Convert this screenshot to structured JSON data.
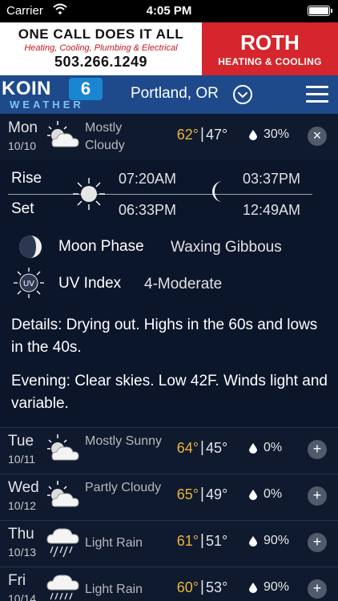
{
  "status_bar": {
    "carrier": "Carrier",
    "time": "4:05 PM"
  },
  "ad": {
    "line1": "ONE CALL DOES IT ALL",
    "line2": "Heating, Cooling, Plumbing & Electrical",
    "phone": "503.266.1249",
    "brand": "ROTH",
    "brand_sub": "HEATING & COOLING"
  },
  "header": {
    "logo_main": "KOIN",
    "logo_number": "6",
    "logo_sub": "WEATHER",
    "location": "Portland, OR"
  },
  "colors": {
    "high_temp": "#eab53a",
    "header_bg": "#1e4a8c",
    "background": "#0f1a2f"
  },
  "days": [
    {
      "name": "Mon",
      "date": "10/10",
      "condition": "Mostly Cloudy",
      "high": "62°",
      "low": "47°",
      "precip": "30%",
      "icon": "partly-cloudy-icon",
      "action": "×"
    },
    {
      "name": "Tue",
      "date": "10/11",
      "condition": "Mostly Sunny",
      "high": "64°",
      "low": "45°",
      "precip": "0%",
      "icon": "partly-cloudy-icon",
      "action": "+"
    },
    {
      "name": "Wed",
      "date": "10/12",
      "condition": "Partly Cloudy",
      "high": "65°",
      "low": "49°",
      "precip": "0%",
      "icon": "partly-cloudy-icon",
      "action": "+"
    },
    {
      "name": "Thu",
      "date": "10/13",
      "condition": "Light Rain",
      "high": "61°",
      "low": "51°",
      "precip": "90%",
      "icon": "rain-cloud-icon",
      "action": "+"
    },
    {
      "name": "Fri",
      "date": "10/14",
      "condition": "Light Rain",
      "high": "60°",
      "low": "53°",
      "precip": "90%",
      "icon": "rain-cloud-icon",
      "action": "+"
    }
  ],
  "details": {
    "rise_label": "Rise",
    "set_label": "Set",
    "sunrise": "07:20AM",
    "sunset": "06:33PM",
    "moonrise": "03:37PM",
    "moonset": "12:49AM",
    "moon_phase_label": "Moon Phase",
    "moon_phase": "Waxing Gibbous",
    "uv_label": "UV Index",
    "uv_value": "4-Moderate",
    "uv_icon_text": "UV",
    "details_text": "Details: Drying out. Highs in the 60s and lows in the 40s.",
    "evening_text": "Evening: Clear skies. Low 42F. Winds light and variable."
  }
}
